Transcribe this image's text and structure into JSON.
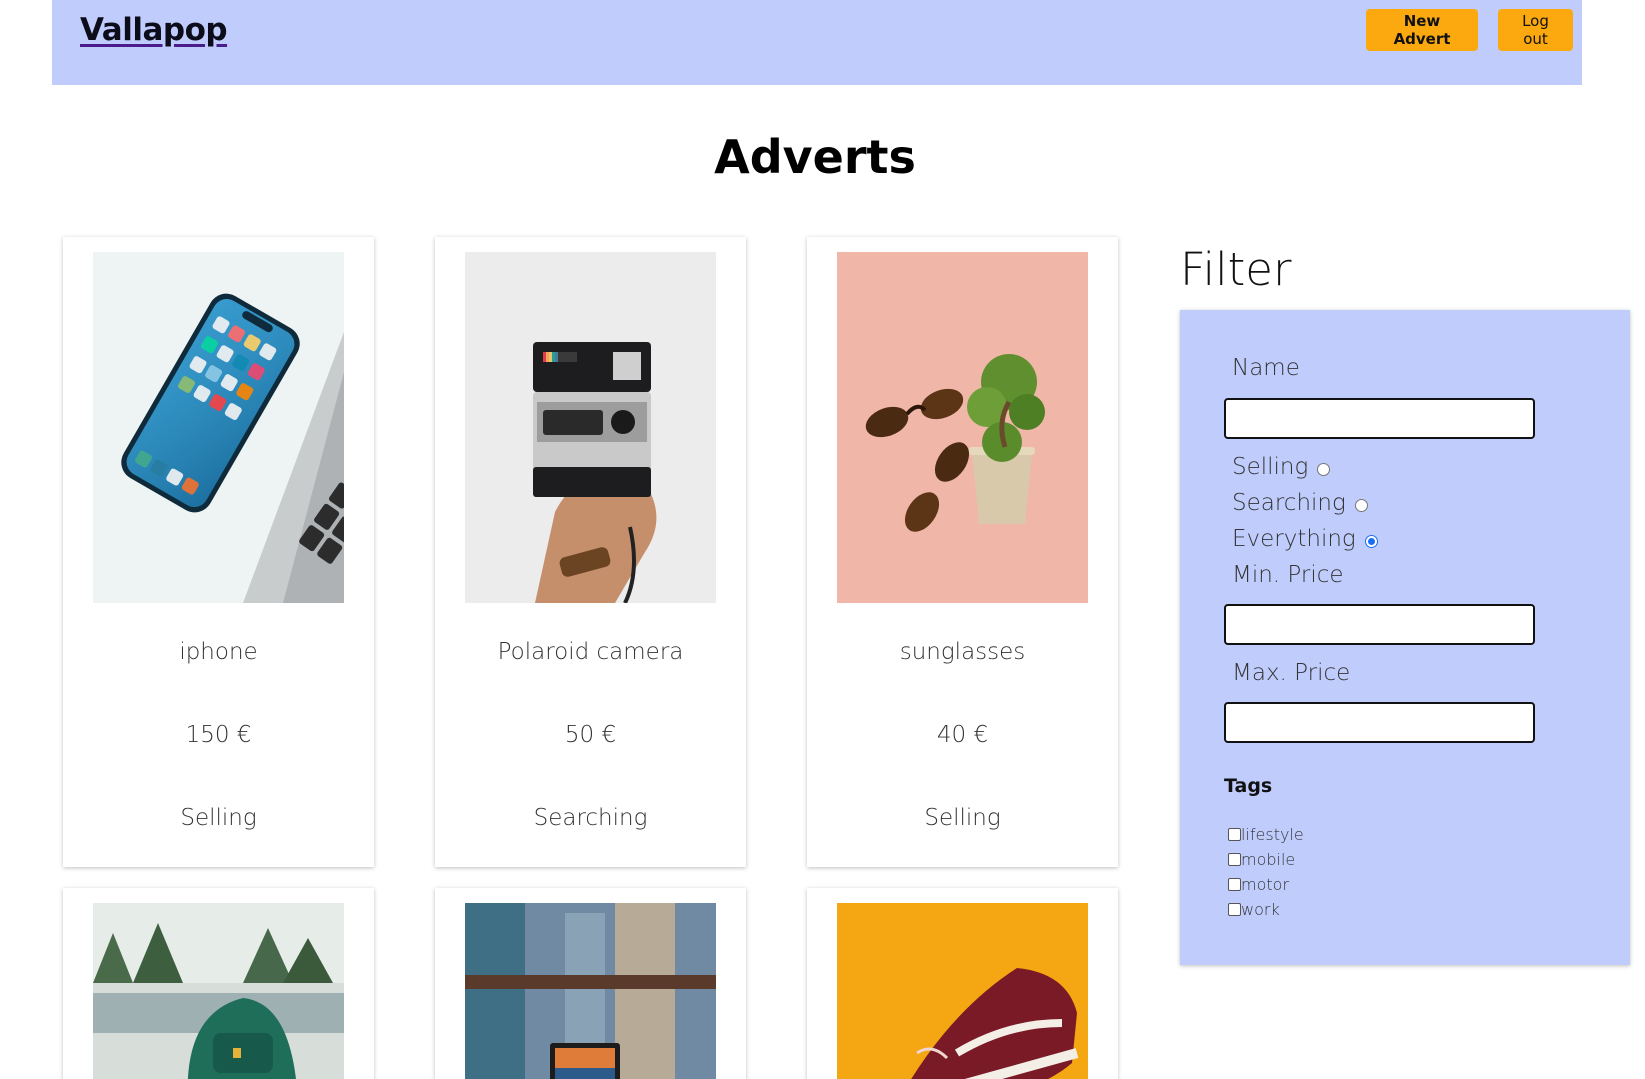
{
  "header": {
    "brand": "Vallapop",
    "new_advert_label": "New Advert",
    "logout_label": "Log out",
    "bg_color": "#c0cdfc",
    "button_color": "#fba90e"
  },
  "main": {
    "title": "Adverts",
    "adverts": [
      {
        "name": "iphone",
        "price": "150 €",
        "type": "Selling",
        "image": "phone-on-laptop-photo"
      },
      {
        "name": "Polaroid camera",
        "price": "50 €",
        "type": "Searching",
        "image": "polaroid-camera-photo"
      },
      {
        "name": "sunglasses",
        "price": "40 €",
        "type": "Selling",
        "image": "sunglasses-and-plant-photo"
      },
      {
        "image": "backpack-photo"
      },
      {
        "image": "laptop-city-photo"
      },
      {
        "image": "sneaker-photo"
      }
    ]
  },
  "filter": {
    "title": "Filter",
    "name_label": "Name",
    "name_value": "",
    "type_options": [
      {
        "label": "Selling",
        "checked": false
      },
      {
        "label": "Searching",
        "checked": false
      },
      {
        "label": "Everything",
        "checked": true
      }
    ],
    "min_price_label": "Min. Price",
    "min_price_value": "",
    "max_price_label": "Max. Price",
    "max_price_value": "",
    "tags_title": "Tags",
    "tags": [
      {
        "label": "lifestyle",
        "checked": false
      },
      {
        "label": "mobile",
        "checked": false
      },
      {
        "label": "motor",
        "checked": false
      },
      {
        "label": "work",
        "checked": false
      }
    ]
  }
}
